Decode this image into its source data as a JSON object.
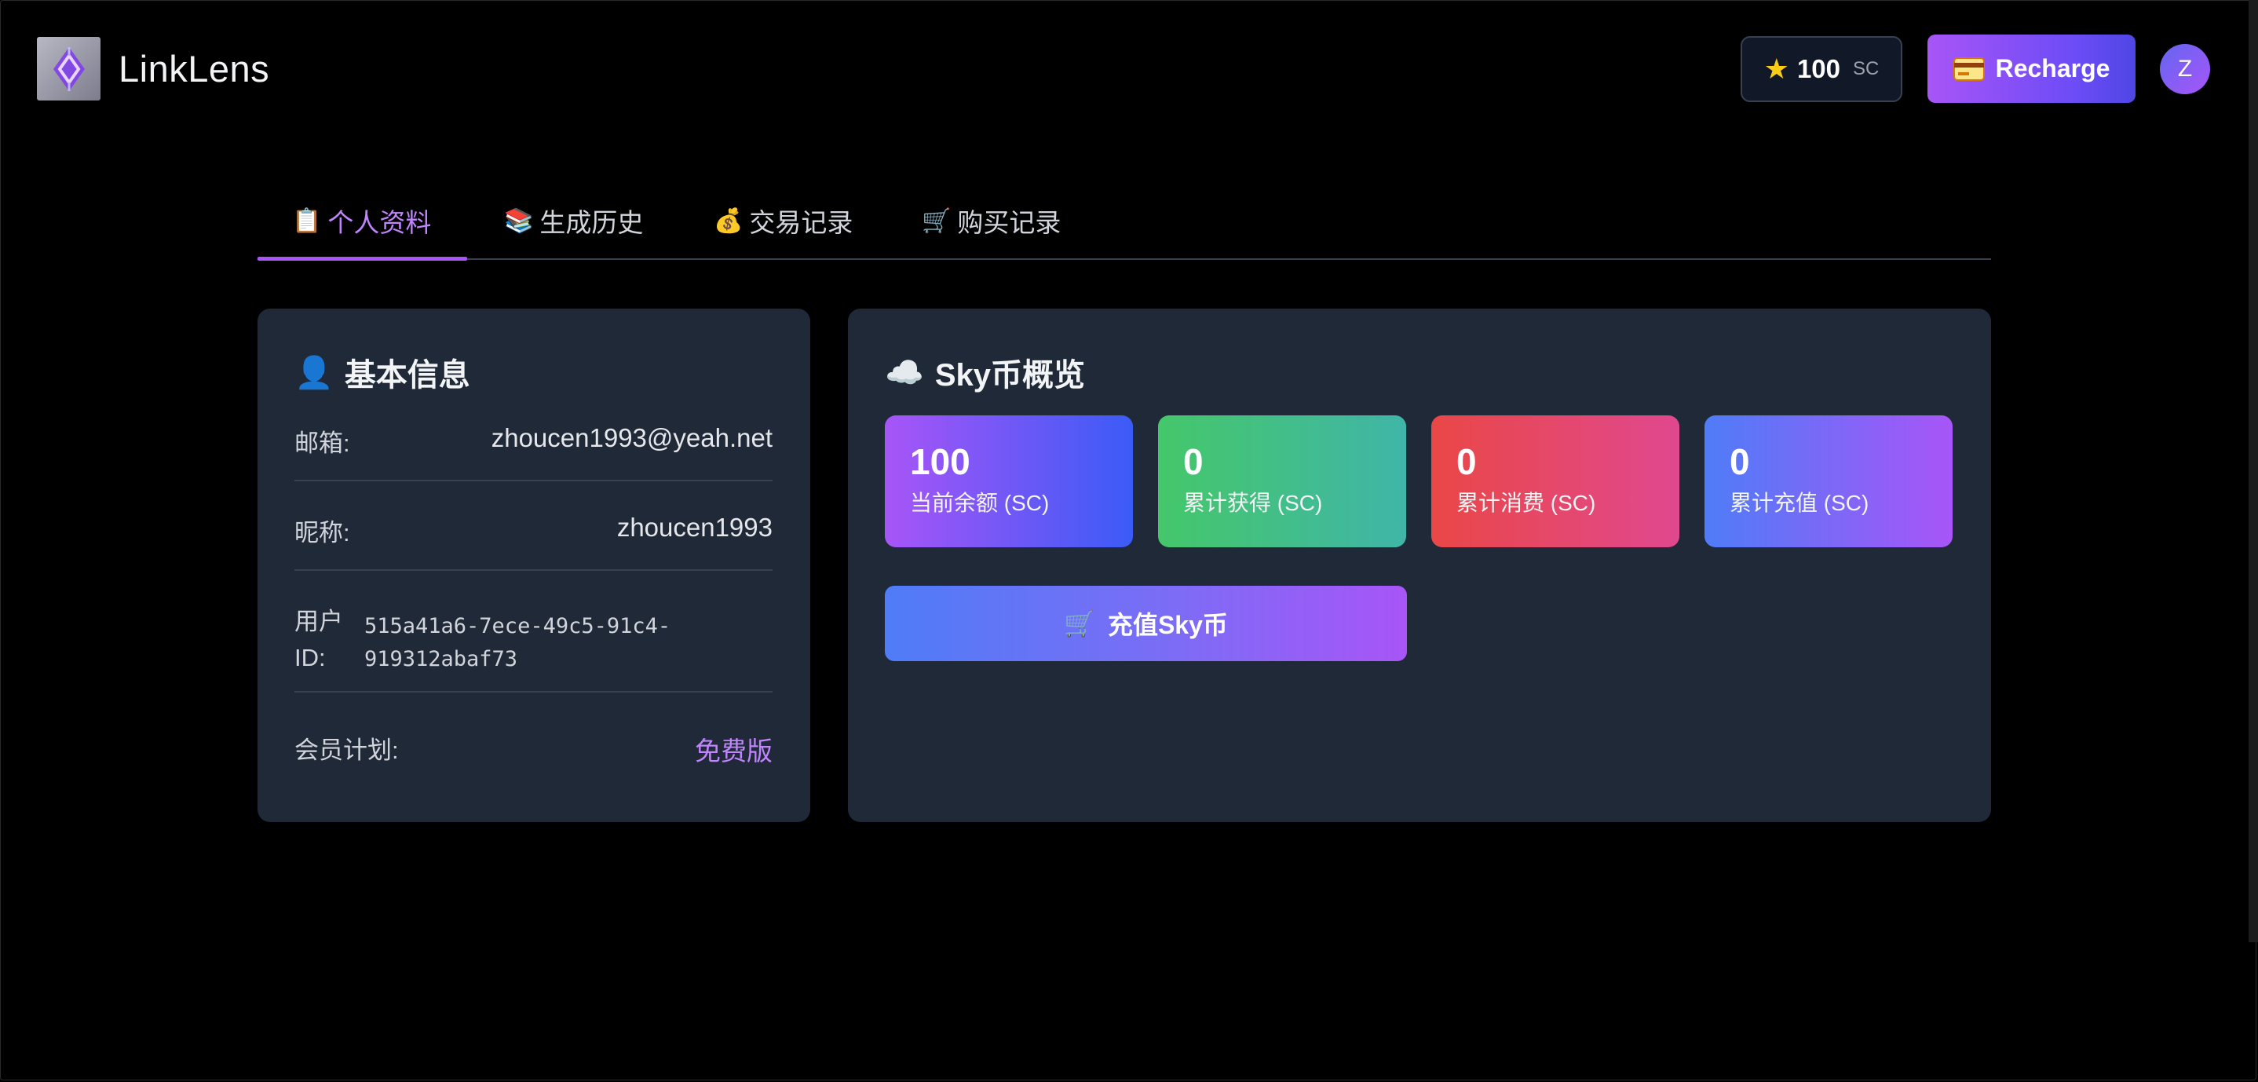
{
  "header": {
    "brand_name": "LinkLens",
    "balance_amount": "100",
    "balance_unit": "SC",
    "recharge_label": "Recharge",
    "avatar_initial": "Z"
  },
  "tabs": [
    {
      "icon": "📋",
      "label": "个人资料",
      "active": true
    },
    {
      "icon": "📚",
      "label": "生成历史",
      "active": false
    },
    {
      "icon": "💰",
      "label": "交易记录",
      "active": false
    },
    {
      "icon": "🛒",
      "label": "购买记录",
      "active": false
    }
  ],
  "basic_info": {
    "title_icon": "👤",
    "title": "基本信息",
    "rows": [
      {
        "label": "邮箱:",
        "value": "zhoucen1993@yeah.net"
      },
      {
        "label": "昵称:",
        "value": "zhoucen1993"
      },
      {
        "label": "用户\nID:",
        "value": "515a41a6-7ece-49c5-91c4-\n919312abaf73"
      },
      {
        "label": "会员计划:",
        "value": "免费版"
      }
    ]
  },
  "sky_overview": {
    "title_icon": "☁️",
    "title": "Sky币概览",
    "stats": [
      {
        "value": "100",
        "label": "当前余额 (SC)"
      },
      {
        "value": "0",
        "label": "累计获得 (SC)"
      },
      {
        "value": "0",
        "label": "累计消费 (SC)"
      },
      {
        "value": "0",
        "label": "累计充值 (SC)"
      }
    ],
    "buy_icon": "🛒",
    "buy_label": "充值Sky币"
  },
  "colors": {
    "accent": "#a855f7",
    "card_bg": "#1f2937",
    "stat_gradients": [
      [
        "#a855f7",
        "#3b5bf6"
      ],
      [
        "#45c76a",
        "#40b5a8"
      ],
      [
        "#ea4747",
        "#e0488f"
      ],
      [
        "#4f7cf7",
        "#a855f7"
      ]
    ]
  }
}
